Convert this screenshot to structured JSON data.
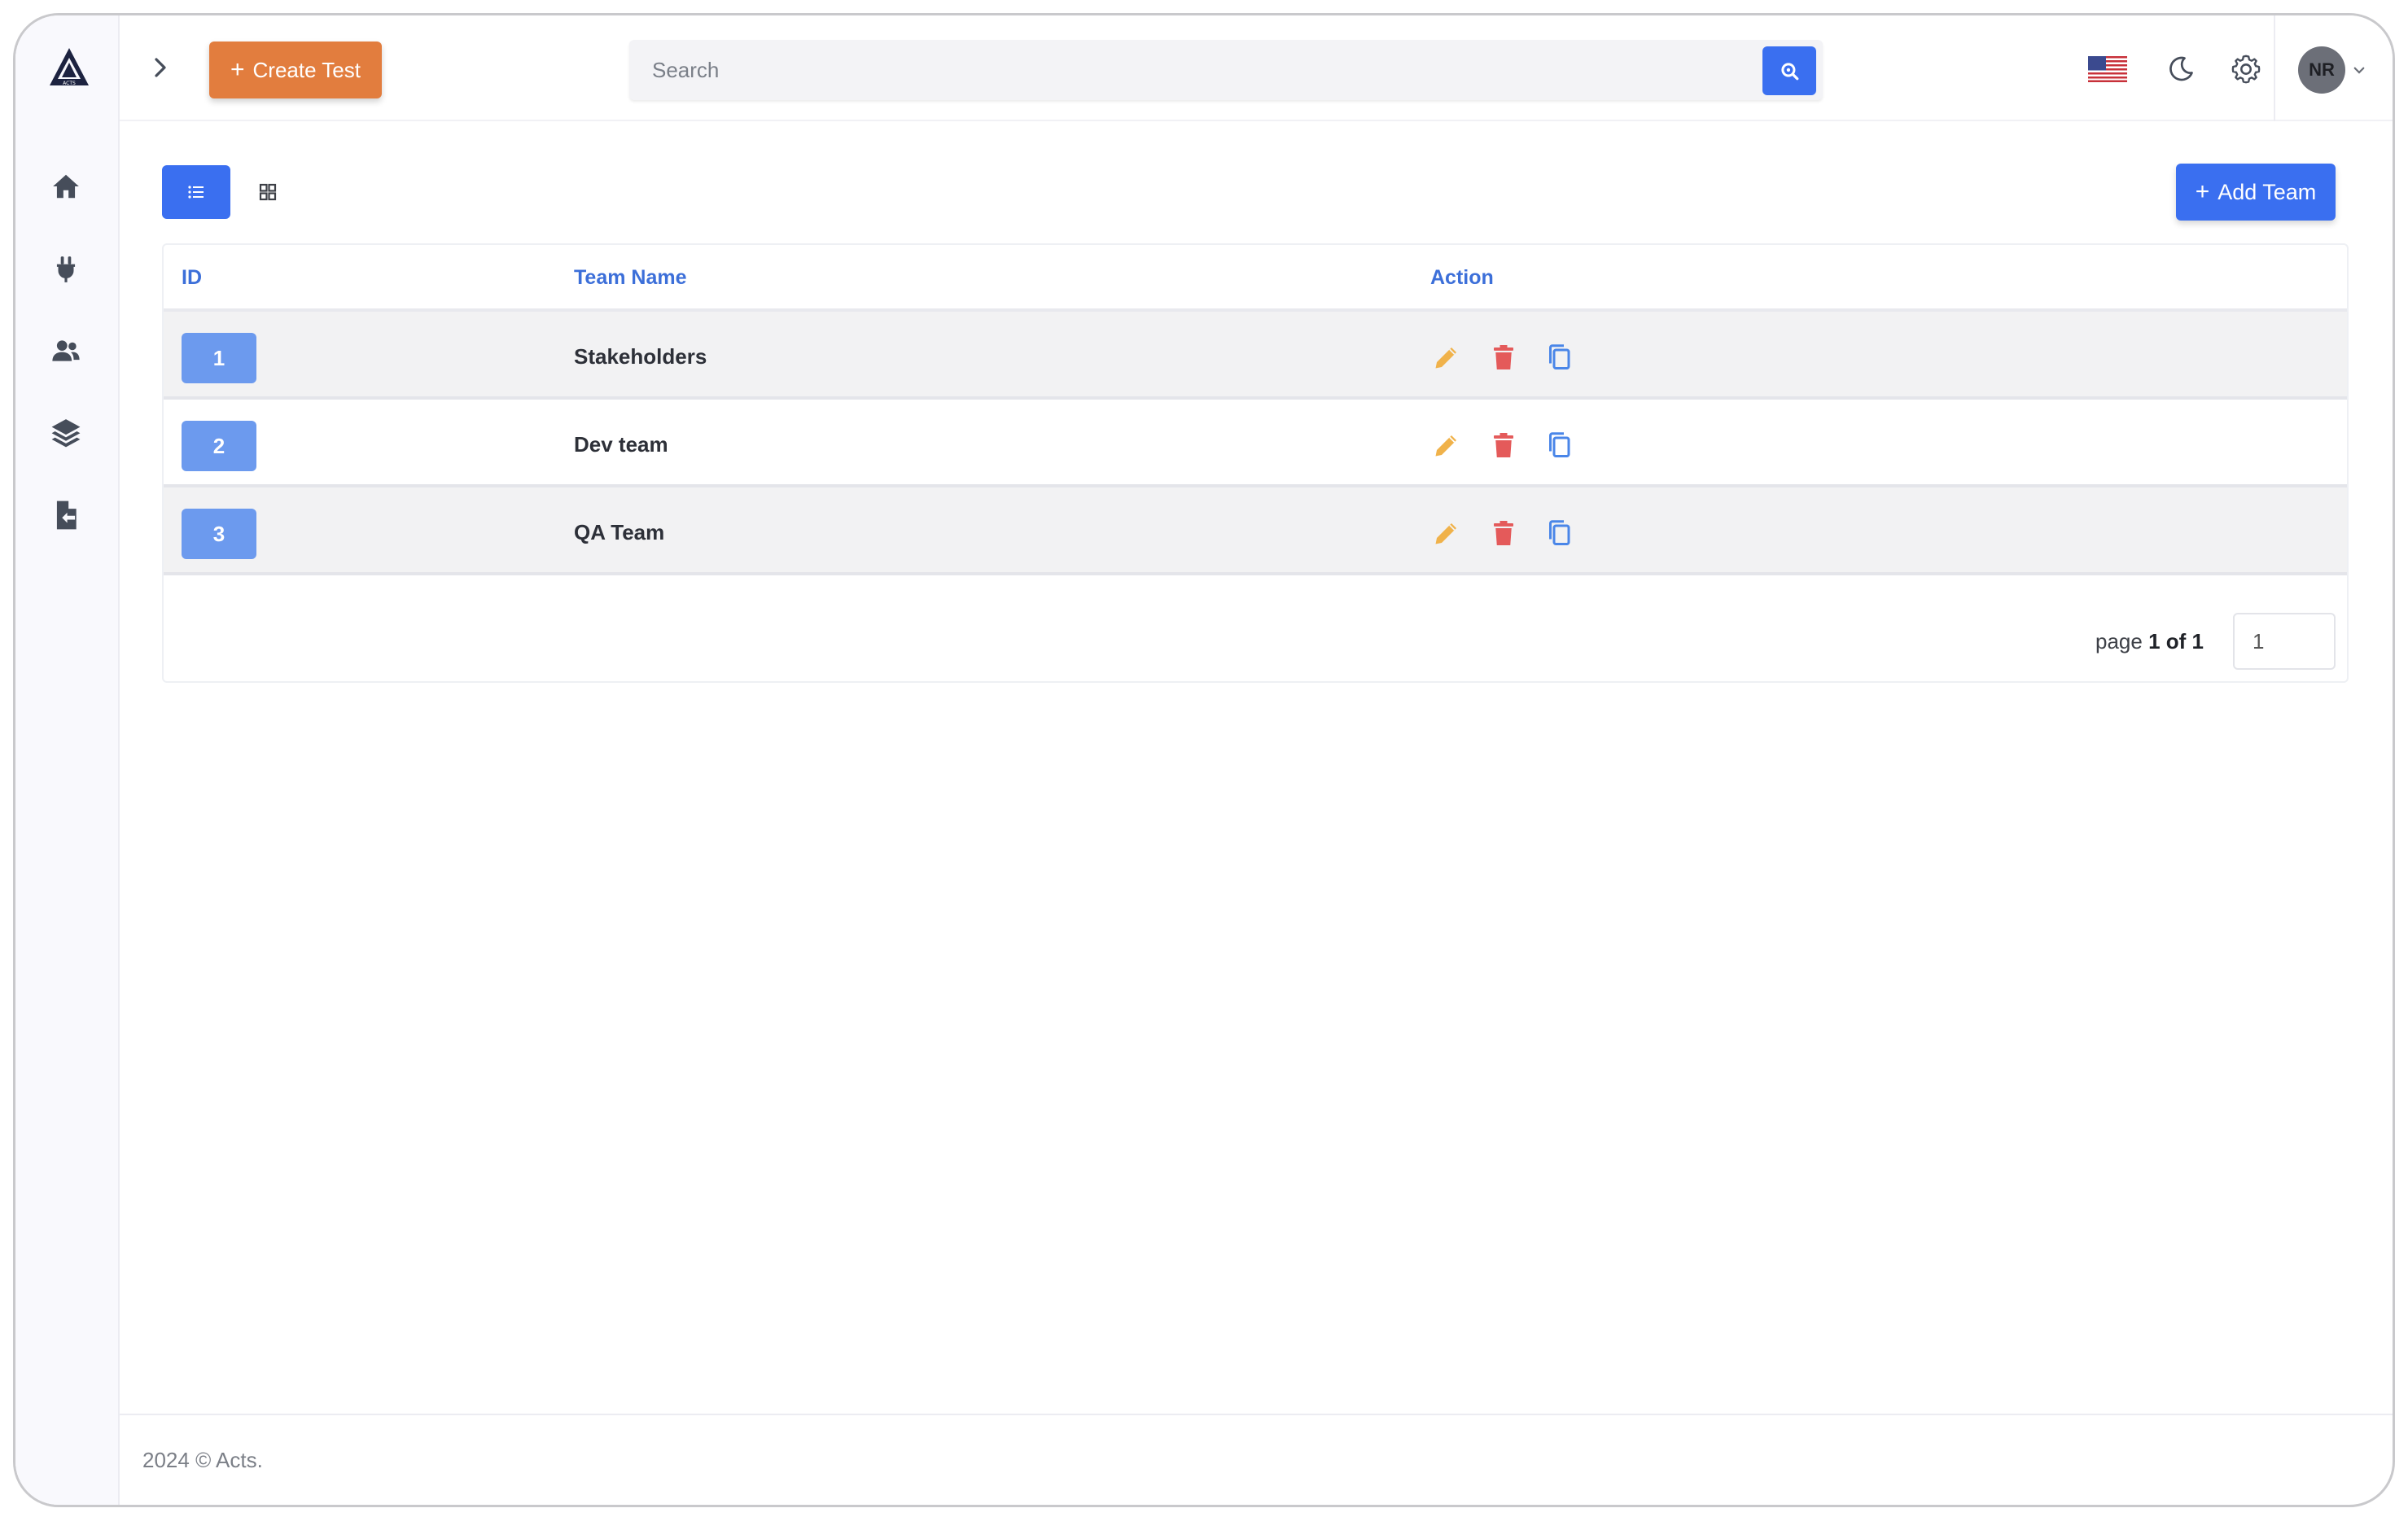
{
  "app": {
    "name": "Acts",
    "logo_text": "ACTS"
  },
  "sidebar": {
    "items": [
      {
        "name": "home",
        "icon": "home-icon"
      },
      {
        "name": "integrations",
        "icon": "plug-icon"
      },
      {
        "name": "teams",
        "icon": "users-icon"
      },
      {
        "name": "projects",
        "icon": "layers-icon"
      },
      {
        "name": "reports",
        "icon": "file-import-icon"
      }
    ]
  },
  "header": {
    "create_label": "Create Test",
    "search_placeholder": "Search",
    "language": "en-US",
    "user_initials": "NR"
  },
  "toolbar": {
    "add_team_label": "Add Team"
  },
  "table": {
    "columns": [
      "ID",
      "Team Name",
      "Action"
    ],
    "rows": [
      {
        "id": "1",
        "name": "Stakeholders"
      },
      {
        "id": "2",
        "name": "Dev team"
      },
      {
        "id": "3",
        "name": "QA Team"
      }
    ]
  },
  "pagination": {
    "prefix": "page",
    "current": "1 of 1",
    "input_value": "1"
  },
  "footer": {
    "text": "2024 © Acts."
  },
  "colors": {
    "primary": "#3a6ff0",
    "create": "#e27d3e",
    "edit": "#f0b24a",
    "delete": "#e45a5a",
    "copy": "#4a86e8"
  }
}
